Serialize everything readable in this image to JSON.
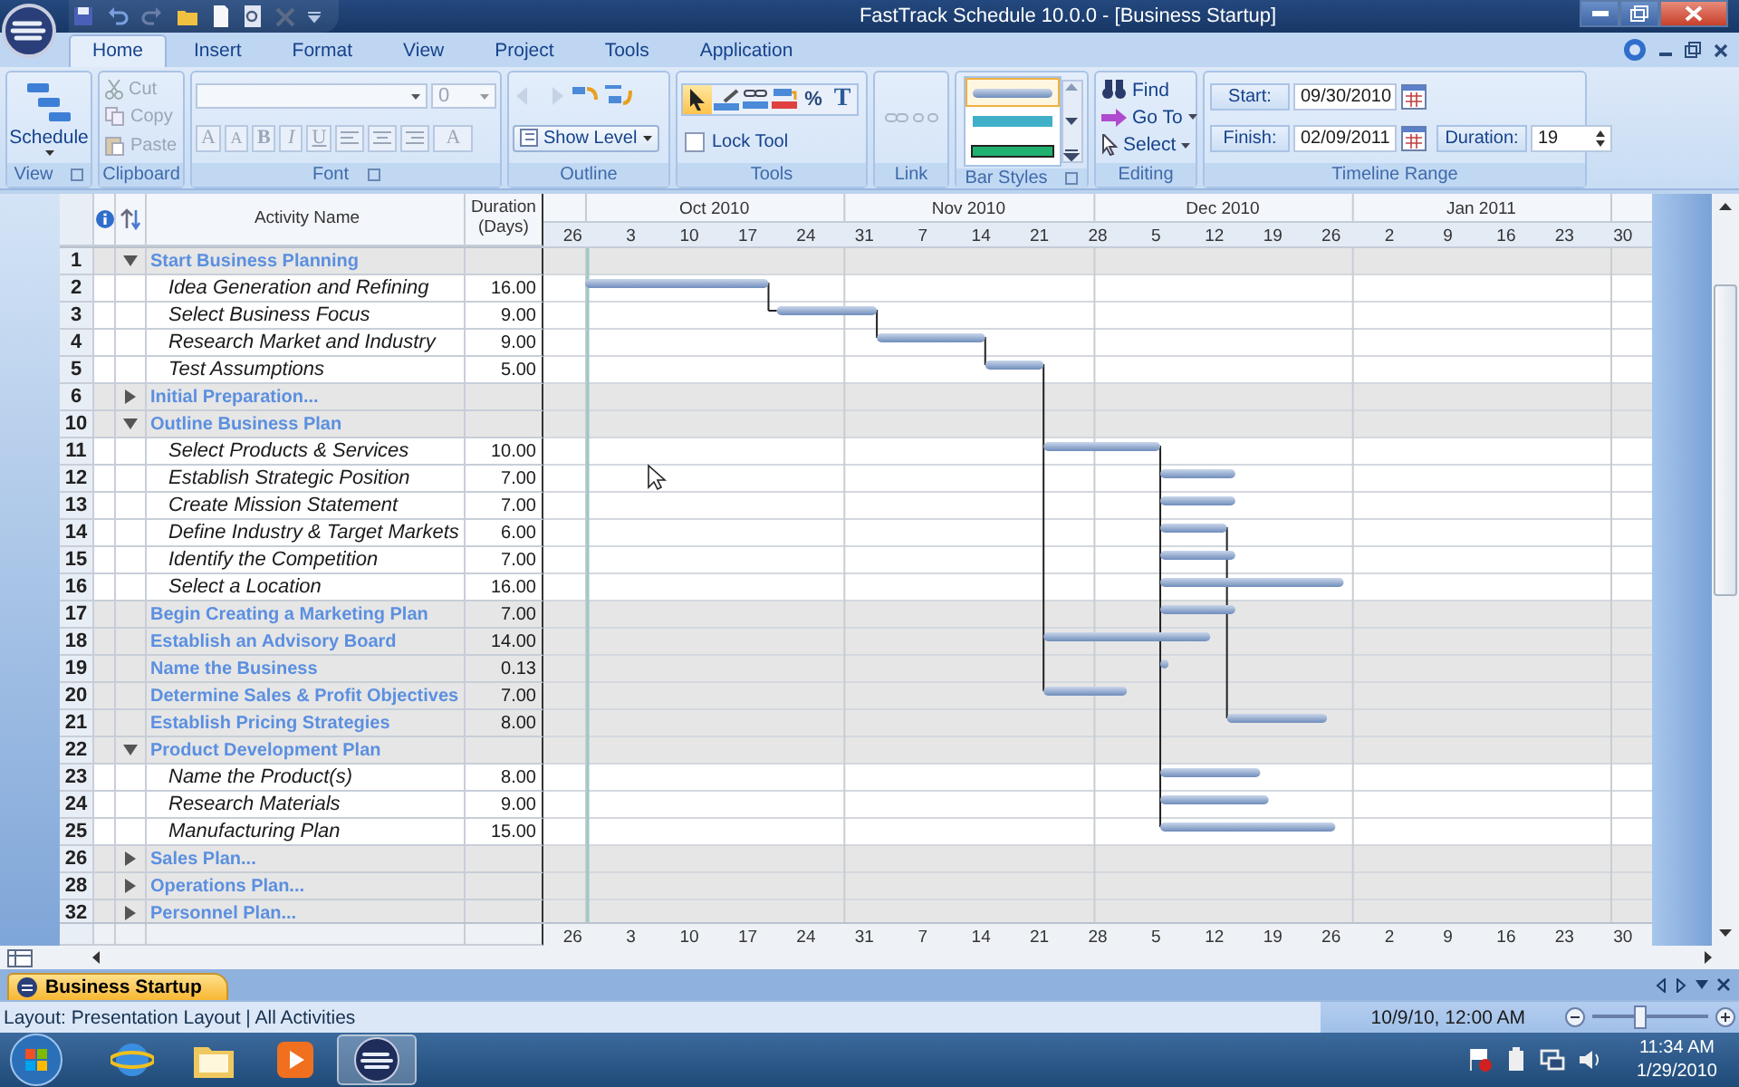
{
  "window": {
    "title": "FastTrack Schedule 10.0.0 - [Business Startup]"
  },
  "ribbon_tabs": [
    {
      "label": "Home",
      "selected": true
    },
    {
      "label": "Insert",
      "selected": false
    },
    {
      "label": "Format",
      "selected": false
    },
    {
      "label": "View",
      "selected": false
    },
    {
      "label": "Project",
      "selected": false
    },
    {
      "label": "Tools",
      "selected": false
    },
    {
      "label": "Application",
      "selected": false
    }
  ],
  "ribbon": {
    "view": {
      "label": "View",
      "schedule": "Schedule"
    },
    "clipboard": {
      "label": "Clipboard",
      "items": [
        {
          "label": "Cut",
          "kind": "cut",
          "disabled": true
        },
        {
          "label": "Copy",
          "kind": "copy",
          "disabled": true
        },
        {
          "label": "Paste",
          "kind": "paste",
          "disabled": true
        }
      ]
    },
    "font": {
      "label": "Font",
      "size": "0",
      "disabled": true,
      "buttons": [
        {
          "label": "A",
          "kind": "grow"
        },
        {
          "label": "A",
          "kind": "shrink"
        },
        {
          "label": "B",
          "kind": "bold"
        },
        {
          "label": "I",
          "kind": "italic"
        },
        {
          "label": "U",
          "kind": "underline"
        }
      ],
      "color_label": "A"
    },
    "outline": {
      "label": "Outline",
      "show_level": "Show Level"
    },
    "tools": {
      "label": "Tools",
      "items": [
        {
          "kind": "pointer",
          "selected": true
        },
        {
          "kind": "draw",
          "selected": false
        },
        {
          "kind": "link",
          "selected": false
        },
        {
          "kind": "color",
          "selected": false
        },
        {
          "kind": "percent",
          "label": "%",
          "selected": false
        },
        {
          "kind": "text",
          "label": "T",
          "selected": false
        }
      ],
      "lock_tool": {
        "label": "Lock Tool",
        "checked": false
      }
    },
    "link": {
      "label": "Link"
    },
    "bar_styles": {
      "label": "Bar Styles",
      "items": [
        {
          "kind": "rounded",
          "selected": true
        },
        {
          "kind": "flat",
          "selected": false
        },
        {
          "kind": "outlined",
          "selected": false
        }
      ]
    },
    "editing": {
      "label": "Editing",
      "items": [
        {
          "label": "Find",
          "kind": "find"
        },
        {
          "label": "Go To",
          "kind": "goto"
        },
        {
          "label": "Select",
          "kind": "select"
        }
      ]
    },
    "timeline_range": {
      "label": "Timeline Range",
      "start_label": "Start:",
      "start": "09/30/2010",
      "finish_label": "Finish:",
      "finish": "02/09/2011",
      "duration_label": "Duration:",
      "duration": "19"
    }
  },
  "grid": {
    "columns": [
      "Activity Name",
      "Duration (Days)"
    ],
    "rows": [
      {
        "id": "1",
        "name": "Start Business Planning",
        "kind": "summary",
        "expanded": true
      },
      {
        "id": "2",
        "name": "Idea Generation and Refining",
        "kind": "task",
        "duration": "16.00"
      },
      {
        "id": "3",
        "name": "Select Business Focus",
        "kind": "task",
        "duration": "9.00"
      },
      {
        "id": "4",
        "name": "Research Market and Industry",
        "kind": "task",
        "duration": "9.00"
      },
      {
        "id": "5",
        "name": "Test Assumptions",
        "kind": "task",
        "duration": "5.00"
      },
      {
        "id": "6",
        "name": "Initial Preparation...",
        "kind": "summary",
        "expanded": false
      },
      {
        "id": "10",
        "name": "Outline Business Plan",
        "kind": "summary",
        "expanded": true
      },
      {
        "id": "11",
        "name": "Select Products & Services",
        "kind": "task",
        "duration": "10.00"
      },
      {
        "id": "12",
        "name": "Establish Strategic Position",
        "kind": "task",
        "duration": "7.00"
      },
      {
        "id": "13",
        "name": "Create Mission Statement",
        "kind": "task",
        "duration": "7.00"
      },
      {
        "id": "14",
        "name": "Define Industry & Target Markets",
        "kind": "task",
        "duration": "6.00"
      },
      {
        "id": "15",
        "name": "Identify the Competition",
        "kind": "task",
        "duration": "7.00"
      },
      {
        "id": "16",
        "name": "Select a Location",
        "kind": "task",
        "duration": "16.00"
      },
      {
        "id": "17",
        "name": "Begin Creating a Marketing Plan",
        "kind": "phase",
        "duration": "7.00"
      },
      {
        "id": "18",
        "name": "Establish an Advisory Board",
        "kind": "phase",
        "duration": "14.00"
      },
      {
        "id": "19",
        "name": "Name the Business",
        "kind": "phase",
        "duration": "0.13"
      },
      {
        "id": "20",
        "name": "Determine Sales & Profit Objectives",
        "kind": "phase",
        "duration": "7.00"
      },
      {
        "id": "21",
        "name": "Establish Pricing Strategies",
        "kind": "phase",
        "duration": "8.00"
      },
      {
        "id": "22",
        "name": "Product Development Plan",
        "kind": "summary",
        "expanded": true
      },
      {
        "id": "23",
        "name": "Name the Product(s)",
        "kind": "task",
        "duration": "8.00"
      },
      {
        "id": "24",
        "name": "Research Materials",
        "kind": "task",
        "duration": "9.00"
      },
      {
        "id": "25",
        "name": "Manufacturing Plan",
        "kind": "task",
        "duration": "15.00"
      },
      {
        "id": "26",
        "name": "Sales Plan...",
        "kind": "summary",
        "expanded": false
      },
      {
        "id": "28",
        "name": "Operations Plan...",
        "kind": "summary",
        "expanded": false
      },
      {
        "id": "32",
        "name": "Personnel Plan...",
        "kind": "summary",
        "expanded": false
      }
    ]
  },
  "timeline": {
    "months": [
      "Oct 2010",
      "Nov 2010",
      "Dec 2010",
      "Jan 2011"
    ],
    "weeks": [
      "26",
      "3",
      "10",
      "17",
      "24",
      "31",
      "7",
      "14",
      "21",
      "28",
      "5",
      "12",
      "19",
      "26",
      "2",
      "9",
      "16",
      "23",
      "30"
    ],
    "footer_weeks": [
      "26",
      "3",
      "10",
      "17",
      "24",
      "31",
      "7",
      "14",
      "21",
      "28",
      "5",
      "12",
      "19",
      "26",
      "2",
      "9",
      "16",
      "23",
      "30"
    ]
  },
  "doc_tabs": [
    {
      "label": "Business Startup",
      "selected": true
    }
  ],
  "status_bar": {
    "text": "Layout: Presentation Layout | All Activities",
    "datetime": "10/9/10, 12:00 AM",
    "zoom": {
      "level": 0.4
    }
  },
  "taskbar": {
    "apps": [
      {
        "kind": "browser",
        "active": false
      },
      {
        "kind": "folder",
        "active": false
      },
      {
        "kind": "media",
        "active": false
      },
      {
        "kind": "schedule",
        "active": true
      }
    ],
    "time": "11:34 AM",
    "date": "1/29/2010"
  }
}
